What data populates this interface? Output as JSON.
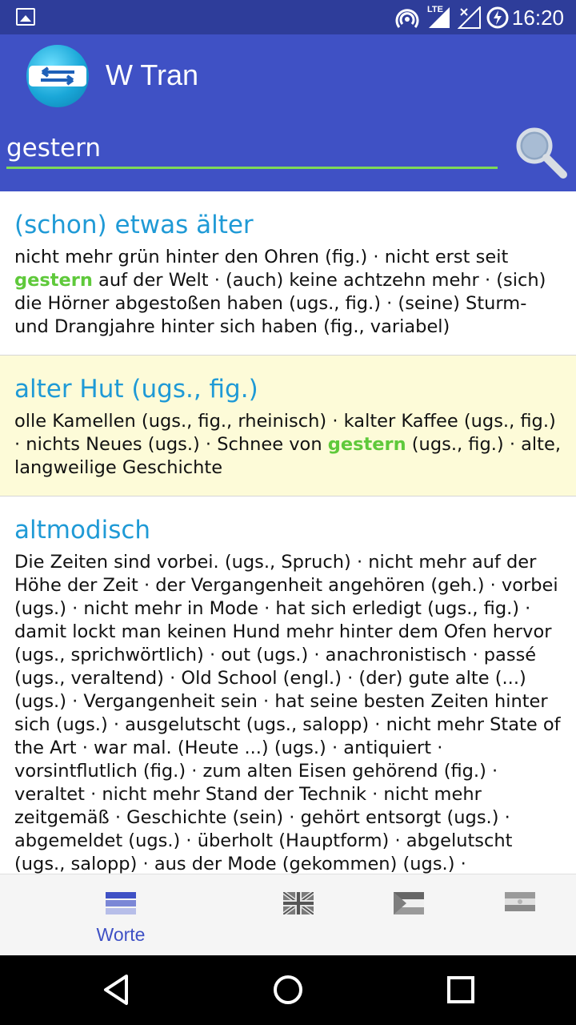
{
  "status_bar": {
    "time": "16:20",
    "network": "LTE"
  },
  "app": {
    "title": "W Tran"
  },
  "search": {
    "value": "gestern"
  },
  "entries": [
    {
      "heading": "(schon) etwas älter",
      "body_parts": [
        "nicht mehr grün hinter den Ohren (fig.) · nicht erst seit ",
        "gestern",
        " auf der Welt · (auch) keine achtzehn mehr · (sich) die Hörner abgestoßen haben (ugs., fig.) · (seine) Sturm- und Drangjahre hinter sich haben (fig., variabel)"
      ]
    },
    {
      "heading": "alter Hut (ugs., fig.)",
      "body_parts": [
        "olle Kamellen (ugs., fig., rheinisch) · kalter Kaffee (ugs., fig.) · nichts Neues (ugs.) · Schnee von ",
        "gestern",
        " (ugs., fig.) · alte, langweilige Geschichte"
      ]
    },
    {
      "heading": "altmodisch",
      "body_parts": [
        "Die Zeiten sind vorbei. (ugs., Spruch) · nicht mehr auf der Höhe der Zeit · der Vergangenheit angehören (geh.) · vorbei (ugs.) · nicht mehr in Mode · hat sich erledigt (ugs., fig.) · damit lockt man keinen Hund mehr hinter dem Ofen hervor (ugs., sprichwörtlich) · out (ugs.) · anachronistisch · passé (ugs., veraltend) · Old School (engl.) · (der) gute alte (...) (ugs.) · Vergangenheit sein · hat seine besten Zeiten hinter sich (ugs.) · ausgelutscht (ugs., salopp) · nicht mehr State of the Art · war mal. (Heute ...) (ugs.) · antiquiert · vorsintflutlich (fig.) · zum alten Eisen gehörend (fig.) · veraltet · nicht mehr Stand der Technik · nicht mehr zeitgemäß · Geschichte (sein) · gehört entsorgt (ugs.) · abgemeldet (ugs.) · überholt (Hauptform) · abgelutscht (ugs., salopp) · aus der Mode (gekommen) (ugs.) · unmodern · uncool (ugs.) · altbacken"
      ]
    }
  ],
  "tabs": [
    {
      "label": "Worte",
      "icon": "words-icon",
      "active": true
    },
    {
      "label": "",
      "icon": "uk-flag-icon",
      "active": false
    },
    {
      "label": "",
      "icon": "palestine-flag-icon",
      "active": false
    },
    {
      "label": "",
      "icon": "flag-icon",
      "active": false
    }
  ],
  "colors": {
    "appbar": "#3f51c5",
    "statusbar": "#2e3d9a",
    "heading": "#1f9ad6",
    "highlight": "#5fc93b",
    "alt_row": "#fdfbd8"
  }
}
